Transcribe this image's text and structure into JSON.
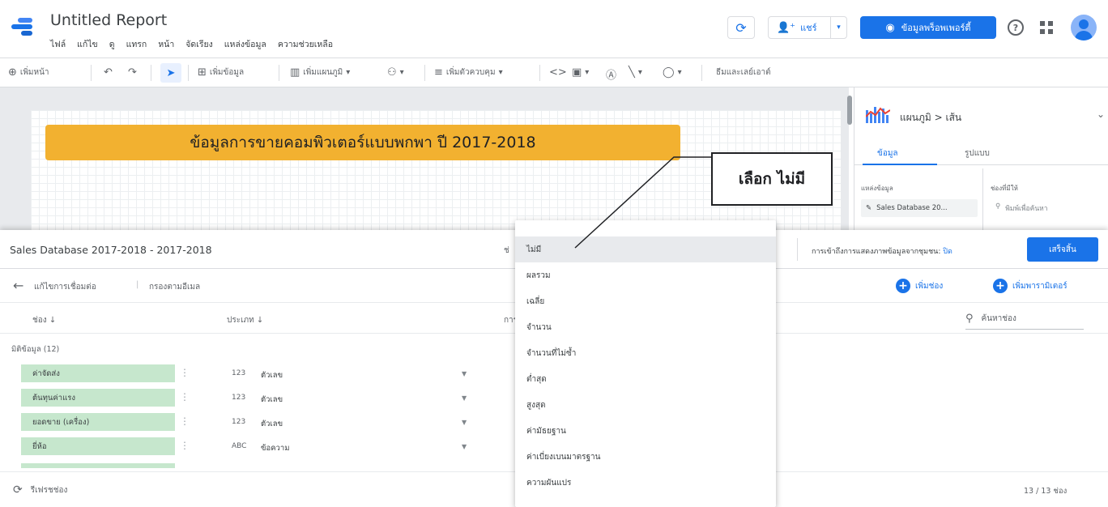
{
  "header": {
    "title": "Untitled Report",
    "menu": [
      "ไฟล์",
      "แก้ไข",
      "ดู",
      "แทรก",
      "หน้า",
      "จัดเรียง",
      "แหล่งข้อมูล",
      "ความช่วยเหลือ"
    ],
    "share_label": "แชร์",
    "view_label": "ข้อมูลพร็อพเพอร์ตี้"
  },
  "toolbar": {
    "add_page": "เพิ่มหน้า",
    "add_data": "เพิ่มข้อมูล",
    "add_chart": "เพิ่มแผนภูมิ",
    "add_control": "เพิ่มตัวควบคุม",
    "theme_layout": "ธีมและเลย์เอาต์"
  },
  "canvas": {
    "banner_title": "ข้อมูลการขายคอมพิวเตอร์แบบพกพา ปี 2017-2018"
  },
  "right_panel": {
    "chart_type": "แผนภูมิ > เส้น",
    "tab_data": "ข้อมูล",
    "tab_style": "รูปแบบ",
    "datasource_label": "แหล่งข้อมูล",
    "datasource_name": "Sales Database 20...",
    "fields_label": "ช่องที่มีให้",
    "search_placeholder": "พิมพ์เพื่อค้นหา"
  },
  "callout": {
    "text": "เลือก ไม่มี"
  },
  "editor": {
    "title": "Sales Database 2017-2018 - 2017-2018",
    "hidden_col_label": "ช่",
    "access_label": "การเข้าถึงการแสดงภาพข้อมูลจากชุมชน:",
    "access_value": "ปิด",
    "finish_label": "เสร็จสิ้น",
    "edit_connection": "แก้ไขการเชื่อมต่อ",
    "filter_email": "กรองตามอีเมล",
    "add_field": "เพิ่มช่อง",
    "add_parameter": "เพิ่มพารามิเตอร์",
    "col_field": "ช่อง",
    "col_type": "ประเภท",
    "col_agg": "การ",
    "search_fields": "ค้นหาช่อง",
    "dimensions_label": "มิติข้อมูล (12)",
    "fields": [
      {
        "name": "ค่าจัดส่ง",
        "code": "123",
        "type": "ตัวเลข"
      },
      {
        "name": "ต้นทุนค่าแรง",
        "code": "123",
        "type": "ตัวเลข"
      },
      {
        "name": "ยอดขาย (เครื่อง)",
        "code": "123",
        "type": "ตัวเลข"
      },
      {
        "name": "ยี่ห้อ",
        "code": "ABC",
        "type": "ข้อความ"
      }
    ],
    "refresh_fields": "รีเฟรชช่อง",
    "field_count": "13 / 13 ช่อง"
  },
  "dropdown": {
    "options": [
      "ไม่มี",
      "ผลรวม",
      "เฉลี่ย",
      "จำนวน",
      "จำนวนที่ไม่ซ้ำ",
      "ต่ำสุด",
      "สูงสุด",
      "ค่ามัธยฐาน",
      "ค่าเบี่ยงเบนมาตรฐาน",
      "ความผันแปร"
    ],
    "selected": "ไม่มี"
  }
}
